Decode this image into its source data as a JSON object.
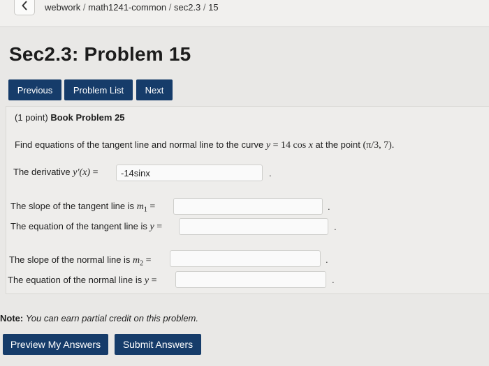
{
  "breadcrumb": {
    "items": [
      "webwork",
      "math1241-common",
      "sec2.3",
      "15"
    ],
    "separator": " / "
  },
  "page": {
    "title": "Sec2.3: Problem 15"
  },
  "nav": {
    "previous": "Previous",
    "problem_list": "Problem List",
    "next": "Next"
  },
  "problem": {
    "points": "(1 point)",
    "book_ref": "Book Problem 25",
    "statement_prefix": "Find equations of the tangent line and normal line to the curve",
    "curve_lhs": "y",
    "curve_eq": " = 14 cos ",
    "curve_var": "x",
    "statement_mid": " at the point ",
    "point": "(π/3, 7).",
    "fields": {
      "derivative": {
        "label_prefix": "The derivative ",
        "label_math": "y′(x)",
        "eq": " = ",
        "value": "-14sinx"
      },
      "tangent_slope": {
        "label_prefix": "The slope of the tangent line is ",
        "label_math": "m",
        "sub": "1",
        "eq": " = ",
        "value": ""
      },
      "tangent_equation": {
        "label_prefix": "The equation of the tangent line is ",
        "label_math": "y",
        "eq": " = ",
        "value": ""
      },
      "normal_slope": {
        "label_prefix": "The slope of the normal line is ",
        "label_math": "m",
        "sub": "2",
        "eq": " = ",
        "value": ""
      },
      "normal_equation": {
        "label_prefix": "The equation of the normal line is ",
        "label_math": "y",
        "eq": " = ",
        "value": ""
      }
    },
    "period": "."
  },
  "note": {
    "label": "Note:",
    "text": "You can earn partial credit on this problem."
  },
  "actions": {
    "preview": "Preview My Answers",
    "submit": "Submit Answers"
  },
  "icons": {
    "back": "chevron-left-icon"
  },
  "colors": {
    "button_bg": "#163c6a",
    "button_text": "#ffffff",
    "page_bg": "#e9e8e6"
  }
}
